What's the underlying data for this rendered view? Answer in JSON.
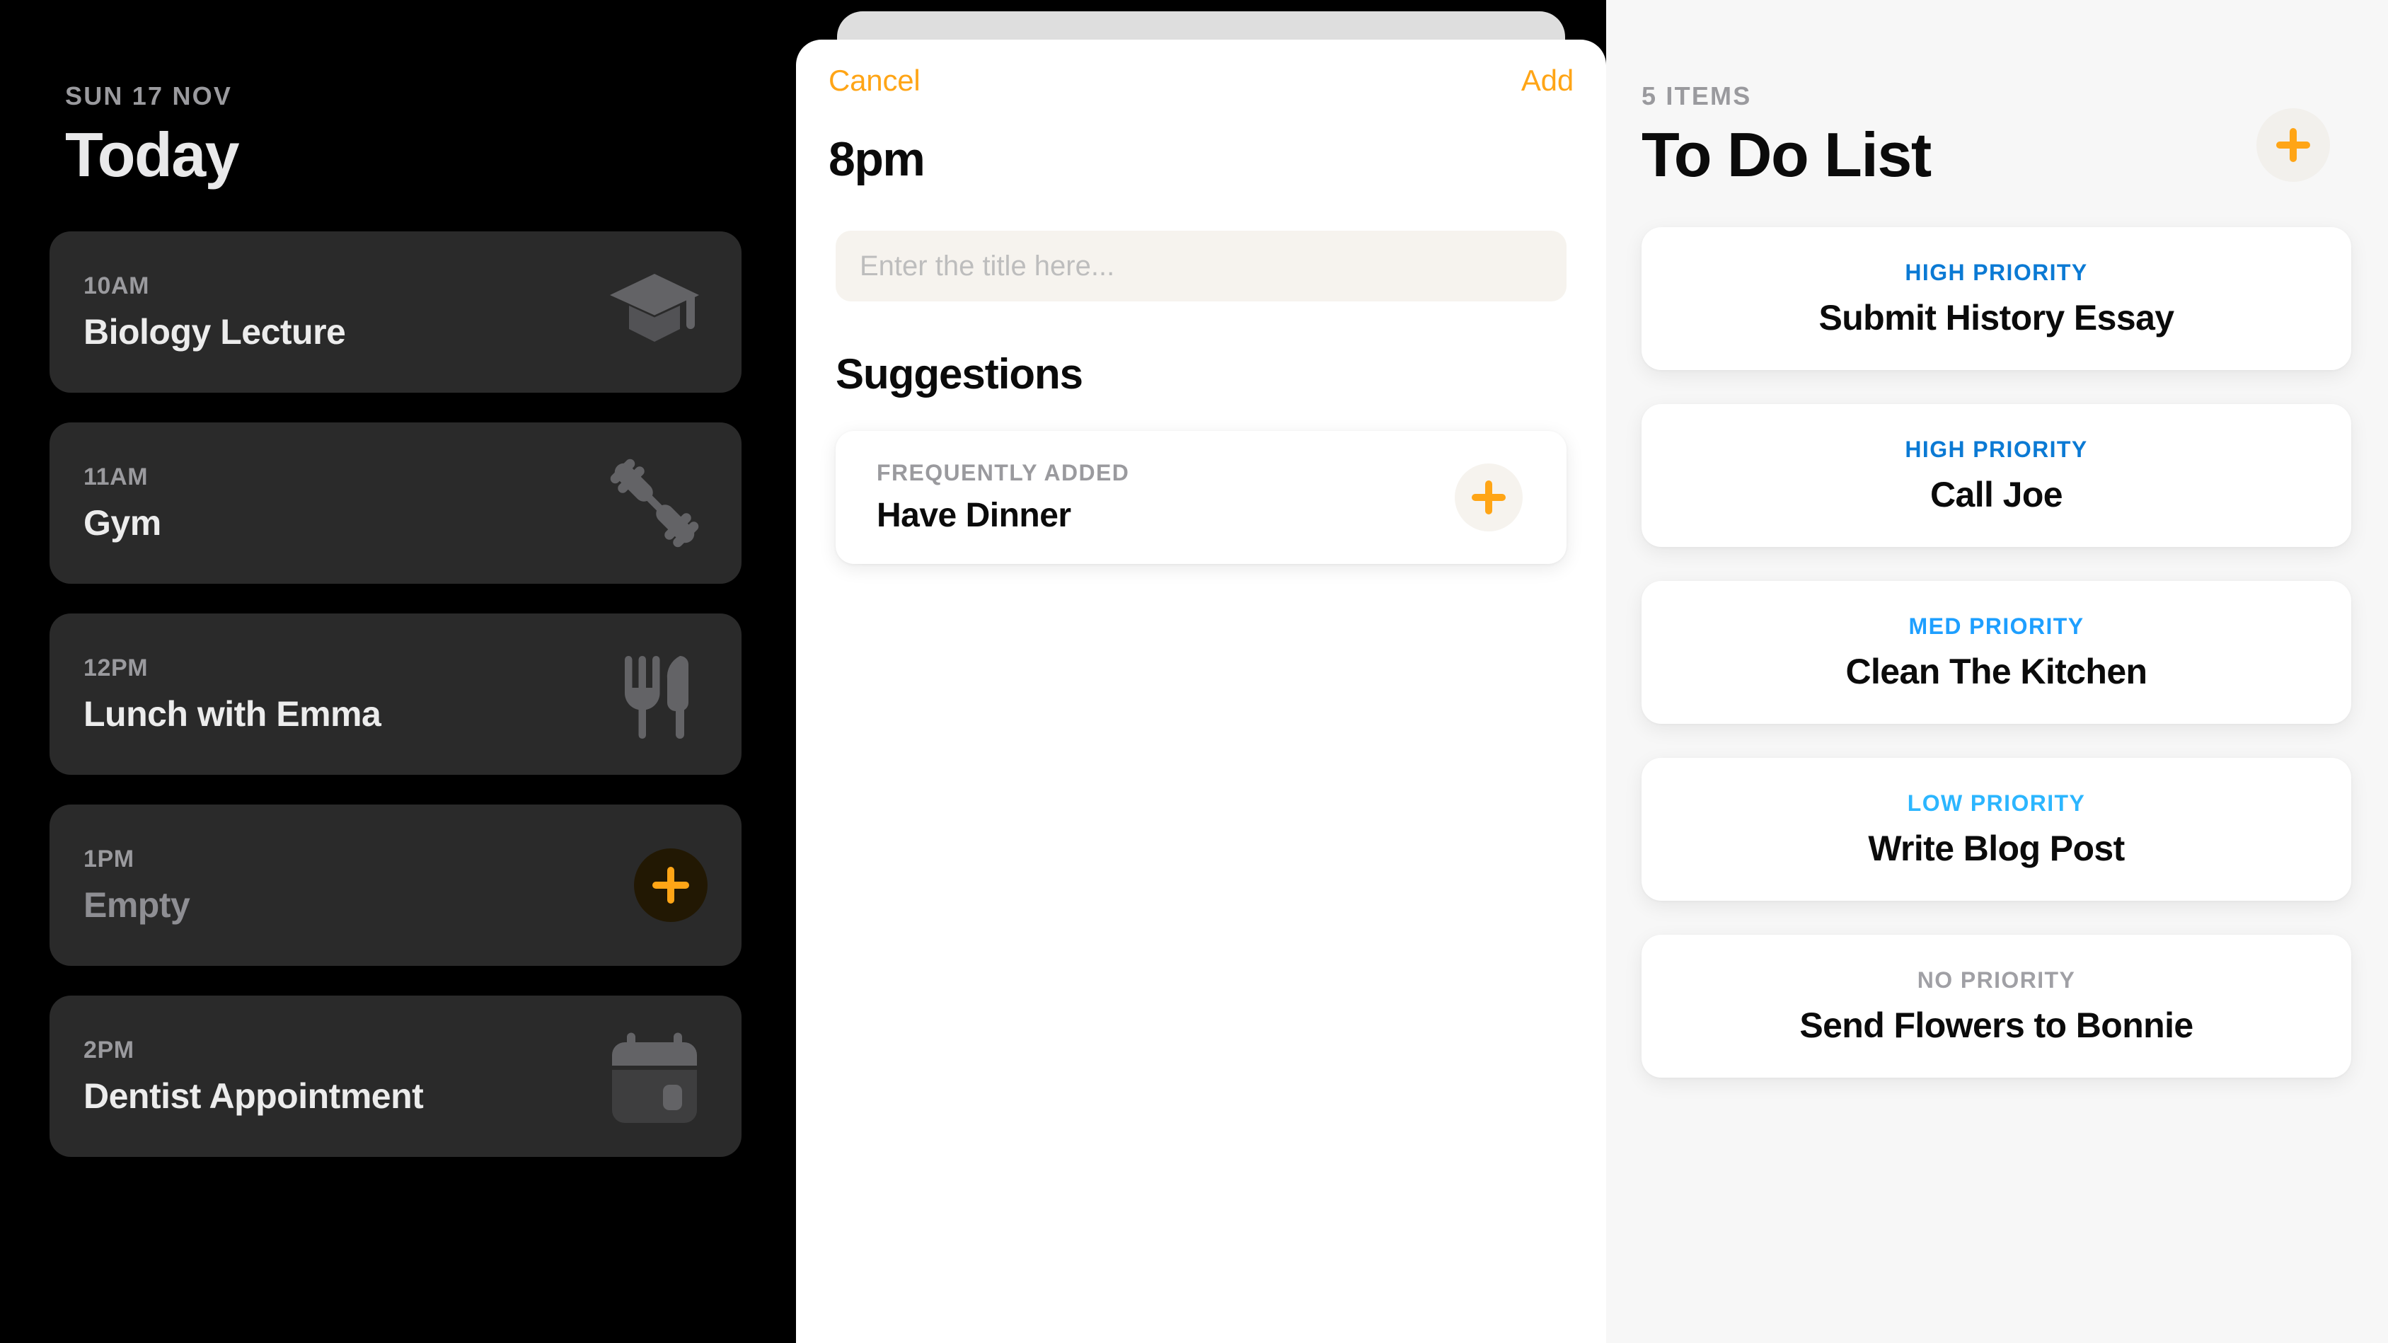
{
  "schedule": {
    "date_label": "SUN 17 NOV",
    "title": "Today",
    "events": [
      {
        "time": "10AM",
        "name": "Biology Lecture",
        "icon": "graduation-cap-icon",
        "muted": false,
        "action": "none"
      },
      {
        "time": "11AM",
        "name": "Gym",
        "icon": "dumbbell-icon",
        "muted": false,
        "action": "none"
      },
      {
        "time": "12PM",
        "name": "Lunch with Emma",
        "icon": "fork-knife-icon",
        "muted": false,
        "action": "none"
      },
      {
        "time": "1PM",
        "name": "Empty",
        "icon": "plus-icon",
        "muted": true,
        "action": "add"
      },
      {
        "time": "2PM",
        "name": "Dentist Appointment",
        "icon": "calendar-icon",
        "muted": false,
        "action": "none"
      }
    ]
  },
  "modal": {
    "cancel_label": "Cancel",
    "add_label": "Add",
    "hour": "8pm",
    "input_placeholder": "Enter the title here...",
    "input_value": "",
    "suggestions_heading": "Suggestions",
    "suggestions": [
      {
        "kicker": "FREQUENTLY ADDED",
        "name": "Have Dinner",
        "add_icon": "plus-icon"
      }
    ]
  },
  "todo": {
    "count_label": "5 ITEMS",
    "title": "To Do List",
    "add_icon": "plus-icon",
    "items": [
      {
        "priority": "HIGH PRIORITY",
        "name": "Submit History Essay",
        "color": "#0B7AD4"
      },
      {
        "priority": "HIGH PRIORITY",
        "name": "Call Joe",
        "color": "#0B7AD4"
      },
      {
        "priority": "MED PRIORITY",
        "name": "Clean The Kitchen",
        "color": "#1E9FFF"
      },
      {
        "priority": "LOW PRIORITY",
        "name": "Write Blog Post",
        "color": "#2CB6FF"
      },
      {
        "priority": "NO PRIORITY",
        "name": "Send Flowers to Bonnie",
        "color": "#A0A0A5"
      }
    ]
  },
  "colors": {
    "accent_orange": "#FFA516",
    "dark_panel": "#000000",
    "dark_card": "#2A2A2A",
    "light_panel": "#F7F7F7",
    "input_bg": "#F6F3EE"
  }
}
